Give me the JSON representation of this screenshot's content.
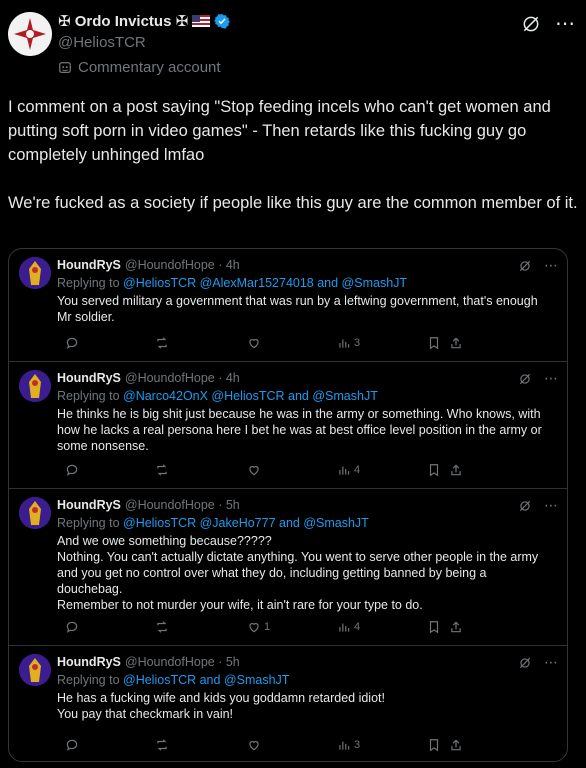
{
  "post": {
    "author_name": "✠ Ordo Invictus ✠",
    "handle": "@HeliosTCR",
    "account_label": "Commentary account",
    "text_p1": "I comment on a post saying \"Stop feeding incels who can't get women and putting soft porn in video games\" - Then retards like this fucking guy go completely unhinged lmfao",
    "text_p2": "We're fucked as a society if people like this guy are the common member of it."
  },
  "replies": [
    {
      "name": "HoundRyS",
      "handle_time": "@HoundofHope · 4h",
      "replying_prefix": "Replying to ",
      "mentions": "@HeliosTCR @AlexMar15274018 and @SmashJT",
      "text": "You served military a government that was run by a leftwing government, that's enough Mr soldier.",
      "likes": "",
      "views": "3"
    },
    {
      "name": "HoundRyS",
      "handle_time": "@HoundofHope · 4h",
      "replying_prefix": "Replying to ",
      "mentions": "@Narco42OnX @HeliosTCR and @SmashJT",
      "text": "He thinks he is big shit just because he was in the army or something. Who knows, with how he lacks a real persona here I bet he was at best office level position in the army or some nonsense.",
      "likes": "",
      "views": "4"
    },
    {
      "name": "HoundRyS",
      "handle_time": "@HoundofHope · 5h",
      "replying_prefix": "Replying to ",
      "mentions": "@HeliosTCR @JakeHo777 and @SmashJT",
      "text": "And we owe something because?????\nNothing. You can't actually dictate anything. You went to serve other people in the army and you get no control over what they do, including getting banned by being a douchebag.\nRemember to not murder your wife, it ain't rare for your type to do.",
      "likes": "1",
      "views": "4"
    },
    {
      "name": "HoundRyS",
      "handle_time": "@HoundofHope · 5h",
      "replying_prefix": "Replying to ",
      "mentions": "@HeliosTCR and @SmashJT",
      "text": "He has a fucking wife and kids you goddamn retarded idiot!\nYou pay that checkmark in vain!",
      "likes": "",
      "views": "3"
    }
  ],
  "icons": {
    "grok": "grok-icon",
    "more": "more-icon",
    "verified": "verified-badge-icon",
    "reply": "reply-icon",
    "repost": "repost-icon",
    "like": "like-icon",
    "views": "views-icon",
    "bookmark": "bookmark-icon",
    "share": "share-icon"
  },
  "colors": {
    "background": "#000000",
    "text": "#e7e9ea",
    "muted": "#71767b",
    "link": "#1d9bf0"
  }
}
